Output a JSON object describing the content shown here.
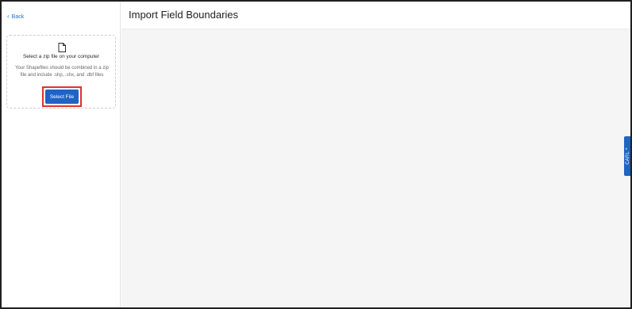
{
  "sidebar": {
    "back_label": "Back",
    "upload": {
      "title": "Select a zip file on your computer",
      "description": "Your Shapefiles should be combined in a zip file and include .shp, .shx, and .dbf files",
      "button_label": "Select File"
    }
  },
  "header": {
    "title": "Import Field Boundaries"
  },
  "side_tab": {
    "label": "CARL ^"
  },
  "colors": {
    "accent": "#1f63c6",
    "link": "#1f6fd1",
    "highlight": "#e03131",
    "canvas": "#f5f5f5"
  },
  "icons": {
    "back": "chevron-left-icon",
    "file": "file-icon"
  }
}
